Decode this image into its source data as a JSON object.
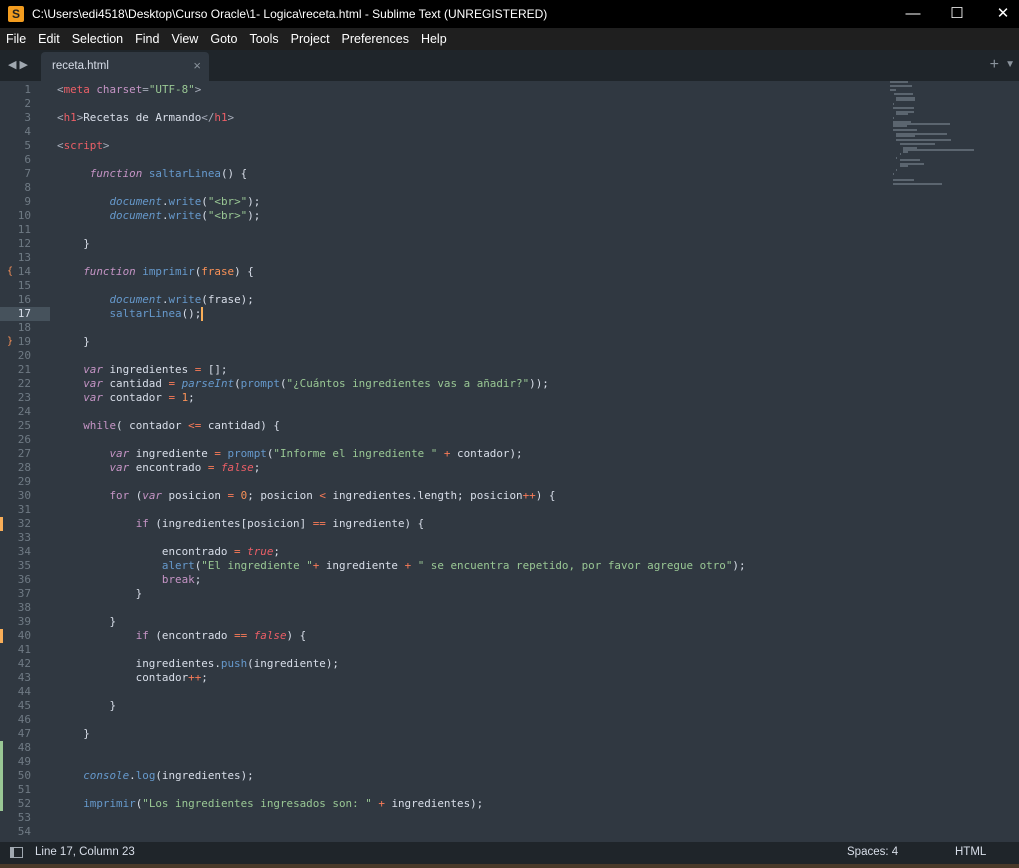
{
  "window": {
    "title": "C:\\Users\\edi4518\\Desktop\\Curso Oracle\\1- Logica\\receta.html - Sublime Text (UNREGISTERED)",
    "app_icon": "sublime-logo",
    "controls": [
      "minimize",
      "maximize",
      "close"
    ]
  },
  "menu": [
    "File",
    "Edit",
    "Selection",
    "Find",
    "View",
    "Goto",
    "Tools",
    "Project",
    "Preferences",
    "Help"
  ],
  "tabs": [
    {
      "label": "receta.html",
      "active": true
    }
  ],
  "editor": {
    "current_line": 17,
    "modified_lines": [
      32,
      40
    ],
    "added_lines": [
      48,
      49,
      50,
      51,
      52
    ],
    "bracket_markers": {
      "14": "{",
      "19": "}"
    },
    "colors": {
      "background": "#303841",
      "caret": "#f9ae58",
      "modified": "#f9ae58",
      "added": "#99c794"
    },
    "lines": [
      [
        [
          "pu",
          "<"
        ],
        [
          "tg",
          "meta"
        ],
        [
          "tx",
          " "
        ],
        [
          "at",
          "charset"
        ],
        [
          "pu",
          "="
        ],
        [
          "st",
          "\"UTF-8\""
        ],
        [
          "pu",
          ">"
        ]
      ],
      [],
      [
        [
          "pu",
          "<"
        ],
        [
          "tg",
          "h1"
        ],
        [
          "pu",
          ">"
        ],
        [
          "tx",
          "Recetas de Armando"
        ],
        [
          "pu",
          "</"
        ],
        [
          "tg",
          "h1"
        ],
        [
          "pu",
          ">"
        ]
      ],
      [],
      [
        [
          "pu",
          "<"
        ],
        [
          "tg",
          "script"
        ],
        [
          "pu",
          ">"
        ]
      ],
      [],
      [
        [
          "tx",
          "     "
        ],
        [
          "kw",
          "function"
        ],
        [
          "tx",
          " "
        ],
        [
          "fn",
          "saltarLinea"
        ],
        [
          "tx",
          "() {"
        ]
      ],
      [],
      [
        [
          "tx",
          "        "
        ],
        [
          "fi",
          "document"
        ],
        [
          "tx",
          "."
        ],
        [
          "fn",
          "write"
        ],
        [
          "tx",
          "("
        ],
        [
          "st",
          "\"<br>\""
        ],
        [
          "tx",
          ");"
        ]
      ],
      [
        [
          "tx",
          "        "
        ],
        [
          "fi",
          "document"
        ],
        [
          "tx",
          "."
        ],
        [
          "fn",
          "write"
        ],
        [
          "tx",
          "("
        ],
        [
          "st",
          "\"<br>\""
        ],
        [
          "tx",
          ");"
        ]
      ],
      [],
      [
        [
          "tx",
          "    }"
        ]
      ],
      [],
      [
        [
          "tx",
          "    "
        ],
        [
          "kw",
          "function"
        ],
        [
          "tx",
          " "
        ],
        [
          "fn",
          "imprimir"
        ],
        [
          "tx",
          "("
        ],
        [
          "pa",
          "frase"
        ],
        [
          "tx",
          ") {"
        ]
      ],
      [],
      [
        [
          "tx",
          "        "
        ],
        [
          "fi",
          "document"
        ],
        [
          "tx",
          "."
        ],
        [
          "fn",
          "write"
        ],
        [
          "tx",
          "(frase);"
        ]
      ],
      [
        [
          "tx",
          "        "
        ],
        [
          "fn",
          "saltarLinea"
        ],
        [
          "tx",
          "();"
        ]
      ],
      [],
      [
        [
          "tx",
          "    }"
        ]
      ],
      [],
      [
        [
          "tx",
          "    "
        ],
        [
          "kw",
          "var"
        ],
        [
          "tx",
          " ingredientes "
        ],
        [
          "op",
          "="
        ],
        [
          "tx",
          " [];"
        ]
      ],
      [
        [
          "tx",
          "    "
        ],
        [
          "kw",
          "var"
        ],
        [
          "tx",
          " cantidad "
        ],
        [
          "op",
          "="
        ],
        [
          "tx",
          " "
        ],
        [
          "fi",
          "parseInt"
        ],
        [
          "tx",
          "("
        ],
        [
          "fn",
          "prompt"
        ],
        [
          "tx",
          "("
        ],
        [
          "st",
          "\"¿Cuántos ingredientes vas a añadir?\""
        ],
        [
          "tx",
          "));"
        ]
      ],
      [
        [
          "tx",
          "    "
        ],
        [
          "kw",
          "var"
        ],
        [
          "tx",
          " contador "
        ],
        [
          "op",
          "="
        ],
        [
          "tx",
          " "
        ],
        [
          "nu",
          "1"
        ],
        [
          "tx",
          ";"
        ]
      ],
      [],
      [
        [
          "tx",
          "    "
        ],
        [
          "kn",
          "while"
        ],
        [
          "tx",
          "( contador "
        ],
        [
          "op",
          "<="
        ],
        [
          "tx",
          " cantidad) {"
        ]
      ],
      [],
      [
        [
          "tx",
          "        "
        ],
        [
          "kw",
          "var"
        ],
        [
          "tx",
          " ingrediente "
        ],
        [
          "op",
          "="
        ],
        [
          "tx",
          " "
        ],
        [
          "fn",
          "prompt"
        ],
        [
          "tx",
          "("
        ],
        [
          "st",
          "\"Informe el ingrediente \""
        ],
        [
          "tx",
          " "
        ],
        [
          "op",
          "+"
        ],
        [
          "tx",
          " contador);"
        ]
      ],
      [
        [
          "tx",
          "        "
        ],
        [
          "kw",
          "var"
        ],
        [
          "tx",
          " encontrado "
        ],
        [
          "op",
          "="
        ],
        [
          "tx",
          " "
        ],
        [
          "bo",
          "false"
        ],
        [
          "tx",
          ";"
        ]
      ],
      [],
      [
        [
          "tx",
          "        "
        ],
        [
          "kn",
          "for"
        ],
        [
          "tx",
          " ("
        ],
        [
          "kw",
          "var"
        ],
        [
          "tx",
          " posicion "
        ],
        [
          "op",
          "="
        ],
        [
          "tx",
          " "
        ],
        [
          "nu",
          "0"
        ],
        [
          "tx",
          "; posicion "
        ],
        [
          "op",
          "<"
        ],
        [
          "tx",
          " ingredientes.length; posicion"
        ],
        [
          "op",
          "++"
        ],
        [
          "tx",
          ") {"
        ]
      ],
      [],
      [
        [
          "tx",
          "            "
        ],
        [
          "kn",
          "if"
        ],
        [
          "tx",
          " (ingredientes[posicion] "
        ],
        [
          "op",
          "=="
        ],
        [
          "tx",
          " ingrediente) {"
        ]
      ],
      [],
      [
        [
          "tx",
          "                encontrado "
        ],
        [
          "op",
          "="
        ],
        [
          "tx",
          " "
        ],
        [
          "bo",
          "true"
        ],
        [
          "tx",
          ";"
        ]
      ],
      [
        [
          "tx",
          "                "
        ],
        [
          "fn",
          "alert"
        ],
        [
          "tx",
          "("
        ],
        [
          "st",
          "\"El ingrediente \""
        ],
        [
          "op",
          "+"
        ],
        [
          "tx",
          " ingrediente "
        ],
        [
          "op",
          "+"
        ],
        [
          "tx",
          " "
        ],
        [
          "st",
          "\" se encuentra repetido, por favor agregue otro\""
        ],
        [
          "tx",
          ");"
        ]
      ],
      [
        [
          "tx",
          "                "
        ],
        [
          "kn",
          "break"
        ],
        [
          "tx",
          ";"
        ]
      ],
      [
        [
          "tx",
          "            }"
        ]
      ],
      [],
      [
        [
          "tx",
          "        }"
        ]
      ],
      [
        [
          "tx",
          "            "
        ],
        [
          "kn",
          "if"
        ],
        [
          "tx",
          " (encontrado "
        ],
        [
          "op",
          "=="
        ],
        [
          "tx",
          " "
        ],
        [
          "bo",
          "false"
        ],
        [
          "tx",
          ") {"
        ]
      ],
      [],
      [
        [
          "tx",
          "            ingredientes."
        ],
        [
          "fn",
          "push"
        ],
        [
          "tx",
          "(ingrediente);"
        ]
      ],
      [
        [
          "tx",
          "            contador"
        ],
        [
          "op",
          "++"
        ],
        [
          "tx",
          ";"
        ]
      ],
      [],
      [
        [
          "tx",
          "        }"
        ]
      ],
      [],
      [
        [
          "tx",
          "    }"
        ]
      ],
      [],
      [],
      [
        [
          "tx",
          "    "
        ],
        [
          "fi",
          "console"
        ],
        [
          "tx",
          "."
        ],
        [
          "fn",
          "log"
        ],
        [
          "tx",
          "(ingredientes);"
        ]
      ],
      [],
      [
        [
          "tx",
          "    "
        ],
        [
          "fn",
          "imprimir"
        ],
        [
          "tx",
          "("
        ],
        [
          "st",
          "\"Los ingredientes ingresados son: \""
        ],
        [
          "tx",
          " "
        ],
        [
          "op",
          "+"
        ],
        [
          "tx",
          " ingredientes);"
        ]
      ],
      [],
      []
    ]
  },
  "status": {
    "position": "Line 17, Column 23",
    "indent": "Spaces: 4",
    "syntax": "HTML"
  }
}
